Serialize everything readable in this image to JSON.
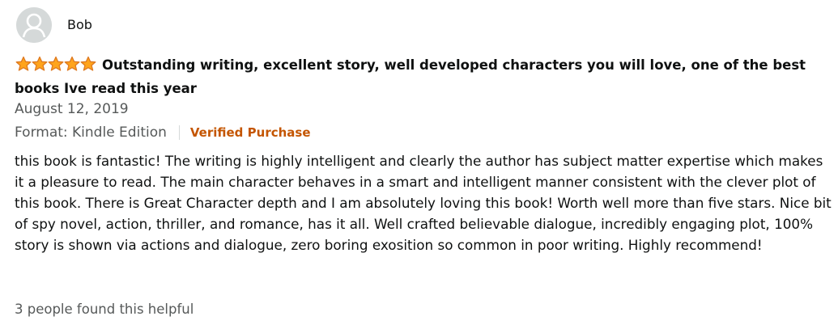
{
  "reviewer": {
    "name": "Bob",
    "avatar_icon": "default-profile-icon"
  },
  "rating": {
    "stars": 5,
    "max_stars": 5,
    "star_color": "#ffa41c",
    "star_outline": "#de7921"
  },
  "review": {
    "title": "Outstanding writing, excellent story, well developed characters you will love, one of the best books Ive read this year",
    "date": "August 12, 2019",
    "format": "Format: Kindle Edition",
    "verified_label": "Verified Purchase",
    "body": "this book is fantastic! The writing is highly intelligent and clearly the author has subject matter expertise which makes it a pleasure to read. The main character behaves in a smart and intelligent manner consistent with the clever plot of this book. There is Great Character depth and I am absolutely loving this book! Worth well more than five stars. Nice bit of spy novel, action, thriller, and romance, has it all. Well crafted believable dialogue, incredibly engaging plot, 100% story is shown via actions and dialogue, zero boring exosition so common in poor writing. Highly recommend!",
    "helpful_text": "3 people found this helpful"
  },
  "colors": {
    "text": "#0f1111",
    "secondary_text": "#565959",
    "verified": "#c45500",
    "avatar_bg": "#d5d9d9"
  }
}
